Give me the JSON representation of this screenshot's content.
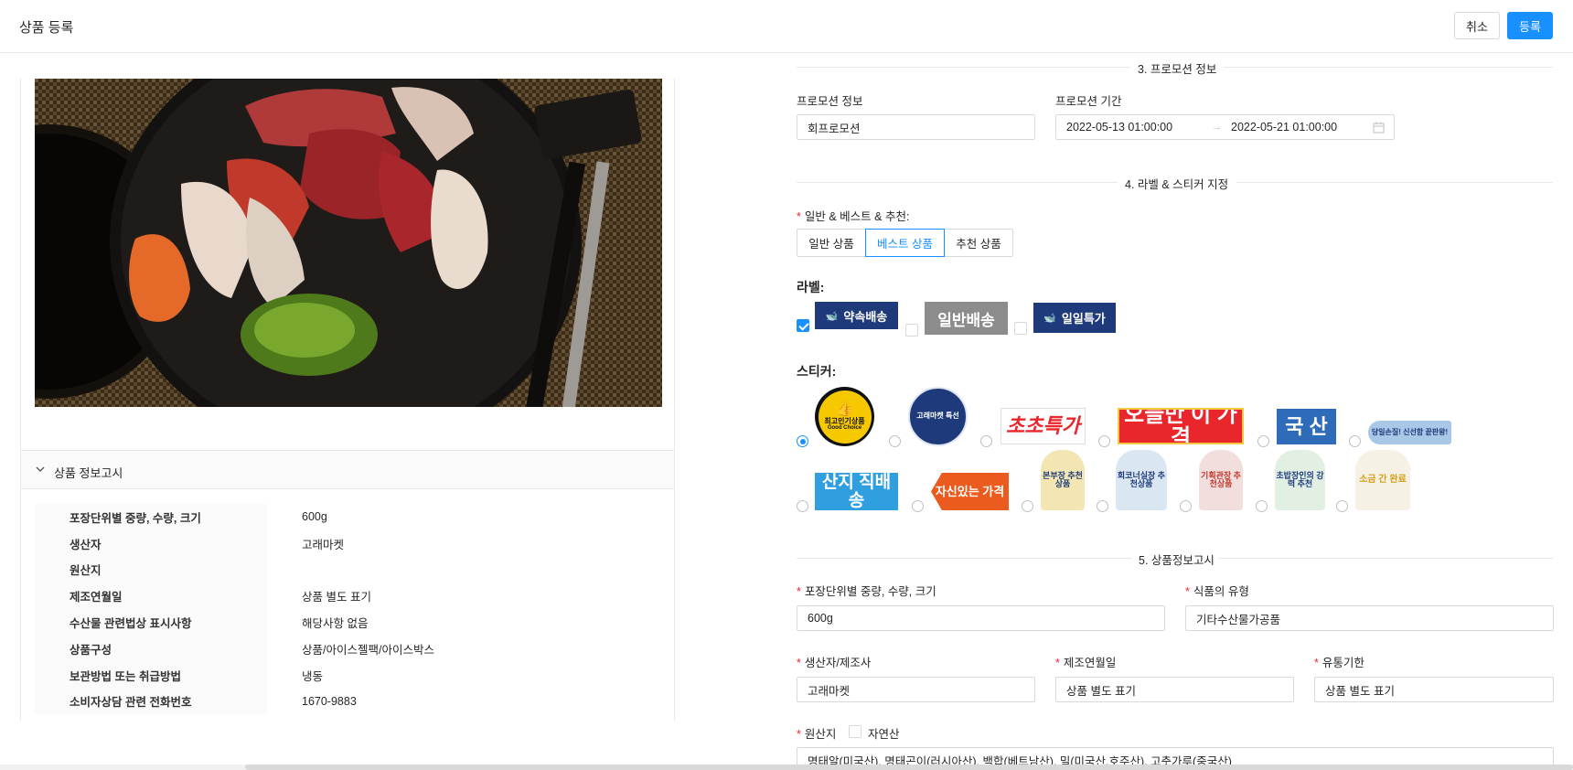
{
  "header": {
    "title": "상품 등록",
    "cancel_label": "취소",
    "submit_label": "등록"
  },
  "left": {
    "accordion_label": "상품 정보고시",
    "info_rows": [
      {
        "key": "포장단위별 중량, 수량, 크기",
        "value": "600g"
      },
      {
        "key": "생산자",
        "value": "고래마켓"
      },
      {
        "key": "원산지",
        "value": ""
      },
      {
        "key": "제조연월일",
        "value": "상품 별도 표기"
      },
      {
        "key": "수산물 관련법상 표시사항",
        "value": "해당사항 없음"
      },
      {
        "key": "상품구성",
        "value": "상품/아이스젤팩/아이스박스"
      },
      {
        "key": "보관방법 또는 취급방법",
        "value": "냉동"
      },
      {
        "key": "소비자상담 관련 전화번호",
        "value": "1670-9883"
      }
    ]
  },
  "promotion": {
    "section_title": "3. 프로모션 정보",
    "info_label": "프로모션 정보",
    "info_value": "회프로모션",
    "period_label": "프로모션 기간",
    "start": "2022-05-13 01:00:00",
    "end": "2022-05-21 01:00:00",
    "range_sep": "→"
  },
  "labels": {
    "section_title": "4. 라벨 & 스티커 지정",
    "type_label": "일반 & 베스트 & 추천:",
    "segments": [
      "일반 상품",
      "베스트 상품",
      "추천 상품"
    ],
    "active_segment": 1,
    "label_title": "라벨:",
    "badges": [
      {
        "text": "약속배송",
        "checked": true,
        "color": "#1e3a7b"
      },
      {
        "text": "일반배송",
        "checked": false,
        "color": "#8c8c8c"
      },
      {
        "text": "일일특가",
        "checked": false,
        "color": "#1e3a7b"
      }
    ],
    "sticker_title": "스티커:",
    "stickers": [
      {
        "text": "최고인기상품",
        "sub": "Good Choice",
        "selected": true
      },
      {
        "text": "고래마켓 특선",
        "selected": false
      },
      {
        "text": "초초특가",
        "selected": false
      },
      {
        "text": "오늘만 이 가격",
        "selected": false
      },
      {
        "text": "국 산",
        "selected": false
      },
      {
        "text": "당일손질! 신선함 끝판왕!",
        "selected": false
      },
      {
        "text": "산지 직배송",
        "selected": false
      },
      {
        "text": "자신있는 가격",
        "selected": false
      },
      {
        "text": "본부장 추천상품",
        "selected": false
      },
      {
        "text": "회코너실장 추천상품",
        "selected": false
      },
      {
        "text": "기획관장 추천상품",
        "selected": false
      },
      {
        "text": "초밥장인의 강력 추천",
        "selected": false
      },
      {
        "text": "소금 간 완료",
        "selected": false
      }
    ]
  },
  "product_info": {
    "section_title": "5. 상품정보고시",
    "weight_label": "포장단위별 중량, 수량, 크기",
    "weight_value": "600g",
    "food_type_label": "식품의 유형",
    "food_type_value": "기타수산물가공품",
    "producer_label": "생산자/제조사",
    "producer_value": "고래마켓",
    "mfg_date_label": "제조연월일",
    "mfg_date_value": "상품 별도 표기",
    "expiry_label": "유통기한",
    "expiry_value": "상품 별도 표기",
    "origin_label": "원산지",
    "natural_label": "자연산",
    "origin_value": "명태알(미국산), 명태곤이(러시아산), 백합(베트남산), 밀(미국산,호주산), 고춧가루(중국산)"
  }
}
